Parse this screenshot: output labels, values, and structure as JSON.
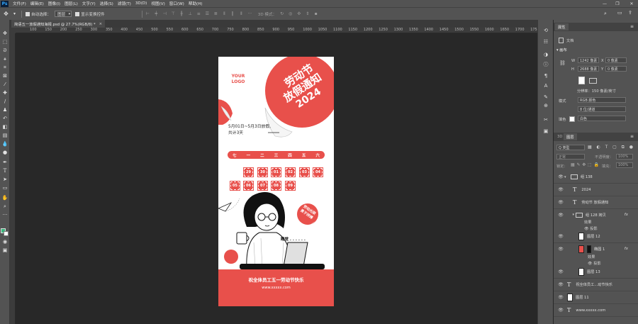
{
  "menu": {
    "logo": "Ps",
    "items": [
      "文件(F)",
      "编辑(E)",
      "图像(I)",
      "图层(L)",
      "文字(Y)",
      "选择(S)",
      "滤镜(T)",
      "3D(D)",
      "视图(V)",
      "窗口(W)",
      "帮助(H)"
    ],
    "minimize": "—",
    "restore": "❐",
    "close": "✕"
  },
  "options": {
    "auto_select_label": "自动选择：",
    "auto_select_value": "图层",
    "show_transform_label": "显示变换控件",
    "mode_label": "3D 模式："
  },
  "document": {
    "tab_title": "简语五一放假通知海报.psd @ 27.7%(RGB/8) *",
    "close": "×"
  },
  "ruler": {
    "labels": [
      "100",
      "150",
      "200",
      "250",
      "300",
      "350",
      "400",
      "450",
      "500",
      "550",
      "600",
      "650",
      "700",
      "750",
      "800",
      "850",
      "900",
      "950",
      "1000",
      "1050",
      "1100",
      "1150",
      "1200",
      "1250",
      "1300",
      "1350",
      "1400",
      "1450",
      "1500",
      "1550",
      "1600",
      "1650",
      "1700",
      "1750"
    ]
  },
  "poster": {
    "logo_line1": "YOUR",
    "logo_line2": "LOGO",
    "title_line1": "劳动节",
    "title_line2": "放假通知",
    "year": "2024",
    "dates": "5月01日~5月3日放假,",
    "total": "共计3天",
    "weekdays": [
      "七",
      "一",
      "二",
      "三",
      "四",
      "五",
      "六"
    ],
    "days_row1": [
      "29",
      "30",
      "01",
      "02",
      "03",
      "04"
    ],
    "days_row2": [
      "05",
      "06",
      "07",
      "08",
      "09"
    ],
    "badge_line1": "劳动光荣",
    "badge_line2": "勇于拼搏",
    "speech": "睡觉 . . . . . .",
    "slogan": "祝全体员工五一劳动节快乐",
    "url": "www.xxxxx.com",
    "accent": "#e8504b"
  },
  "properties": {
    "tab_props": "属性",
    "doc_label": "文档",
    "canvas_label": "画布",
    "w_label": "W",
    "w_value": "1242 像素",
    "x_label": "X",
    "x_value": "0 像素",
    "h_label": "H",
    "h_value": "2688 像素",
    "y_label": "Y",
    "y_value": "0 像素",
    "resolution": "分辨率：150 像素/英寸",
    "mode_label": "模式",
    "mode_value": "RGB 颜色",
    "depth_value": "8 位/通道",
    "fill_label": "填色",
    "fill_value": "白色"
  },
  "layers": {
    "tab_3d": "3D",
    "tab_layers": "图层",
    "kind_value": "Q 类型",
    "blend_value": "正常",
    "opacity_label": "不透明度：",
    "opacity_value": "100%",
    "lock_label": "锁定：",
    "fill_label": "填充：",
    "fill_value": "100%",
    "rows": [
      {
        "name": "组 138",
        "kind": "group"
      },
      {
        "name": "2024",
        "kind": "text"
      },
      {
        "name": "劳动节 放假通知",
        "kind": "text"
      },
      {
        "name": "组 128 拷贝",
        "kind": "group",
        "fx": "fx"
      },
      {
        "name": "效果",
        "kind": "effect"
      },
      {
        "name": "投影",
        "kind": "effect"
      },
      {
        "name": "图层 12",
        "kind": "image"
      },
      {
        "name": "椭圆 1",
        "kind": "shape",
        "fx": "fx"
      },
      {
        "name": "效果",
        "kind": "effect"
      },
      {
        "name": "投影",
        "kind": "effect"
      },
      {
        "name": "图层 13",
        "kind": "image"
      },
      {
        "name": "祝全体员工...动节快乐",
        "kind": "text"
      },
      {
        "name": "图层 11",
        "kind": "image"
      },
      {
        "name": "www.xxxxx.com",
        "kind": "text"
      }
    ]
  }
}
